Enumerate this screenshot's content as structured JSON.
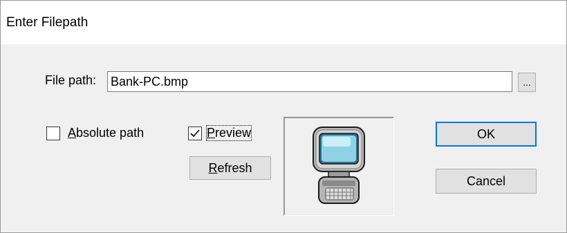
{
  "window": {
    "title": "Enter Filepath"
  },
  "filepath": {
    "label": "File path:",
    "value": "Bank-PC.bmp",
    "browse_label": "..."
  },
  "absolute_path": {
    "label_prefix": "",
    "mnemonic": "A",
    "label_rest": "bsolute path",
    "checked": false
  },
  "preview": {
    "mnemonic": "P",
    "label_rest": "review",
    "checked": true,
    "image_icon": "computer-icon"
  },
  "refresh_button": {
    "mnemonic": "R",
    "label_rest": "efresh"
  },
  "ok_button": {
    "label": "OK"
  },
  "cancel_button": {
    "label": "Cancel"
  },
  "colors": {
    "focus_border": "#0078d7",
    "dialog_bg": "#f0f0f0",
    "button_bg": "#e1e1e1"
  }
}
